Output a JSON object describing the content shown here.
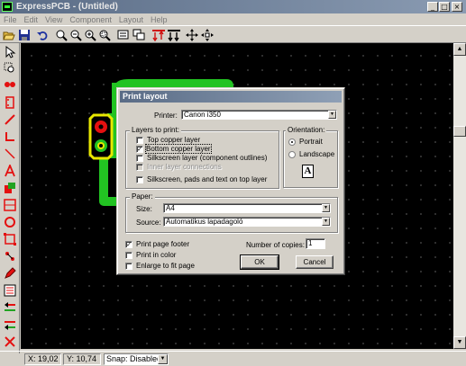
{
  "window": {
    "title": "ExpressPCB - (Untitled)",
    "controls": [
      "_",
      "□",
      "×"
    ]
  },
  "menu": [
    "File",
    "Edit",
    "View",
    "Component",
    "Layout",
    "Help"
  ],
  "toolbar": {
    "buttons": [
      "open-icon",
      "save-icon",
      "undo-icon",
      "zoom-fit-icon",
      "zoom-out-icon",
      "zoom-in-icon",
      "zoom-area-icon",
      "component-properties-icon",
      "ratsnest-icon",
      "flip-layer-icon",
      "switch-layer-icon",
      "rotate-icon",
      "move-icon"
    ]
  },
  "palette": {
    "tools": [
      "pointer",
      "zoom-select",
      "place-pad",
      "place-component",
      "draw-trace",
      "draw-line",
      "trace-corner",
      "place-text",
      "filled-area",
      "place-via",
      "draw-circle",
      "draw-rectangle",
      "edit-nodes",
      "text-edit",
      "netlist",
      "layer-top",
      "layer-bottom",
      "layer-silkscreen",
      "delete-node"
    ]
  },
  "status": {
    "x": "X: 19,02",
    "y": "Y: 10,74",
    "snap": "Snap: Disabled"
  },
  "dialog": {
    "title": "Print layout",
    "printer_label": "Printer:",
    "printer_value": "Canon i350",
    "layers_group": "Layers to print:",
    "layers": [
      {
        "label": "Top copper layer",
        "checked": false,
        "enabled": true
      },
      {
        "label": "Bottom copper layer",
        "checked": true,
        "enabled": true
      },
      {
        "label": "Silkscreen layer (component outlines)",
        "checked": false,
        "enabled": true
      },
      {
        "label": "Inner layer connections",
        "checked": false,
        "enabled": false
      }
    ],
    "silkscreen_top": "Silkscreen, pads and text on top layer",
    "orientation_group": "Orientation:",
    "portrait": "Portrait",
    "landscape": "Landscape",
    "orientation_selected": "Portrait",
    "orientation_icon": "A",
    "paper_group": "Paper:",
    "size_label": "Size:",
    "size_value": "A4",
    "source_label": "Source:",
    "source_value": "Automatikus lapadagoló",
    "print_footer": "Print page footer",
    "print_footer_checked": true,
    "print_color": "Print in color",
    "print_color_checked": false,
    "enlarge": "Enlarge to fit page",
    "enlarge_checked": false,
    "copies_label": "Number of copies:",
    "copies_value": "1",
    "ok": "OK",
    "cancel": "Cancel"
  },
  "colors": {
    "copper_bottom": "#22c322",
    "pad_red": "#e41010",
    "pad_outline": "#e8e800",
    "canvas": "#000000"
  }
}
